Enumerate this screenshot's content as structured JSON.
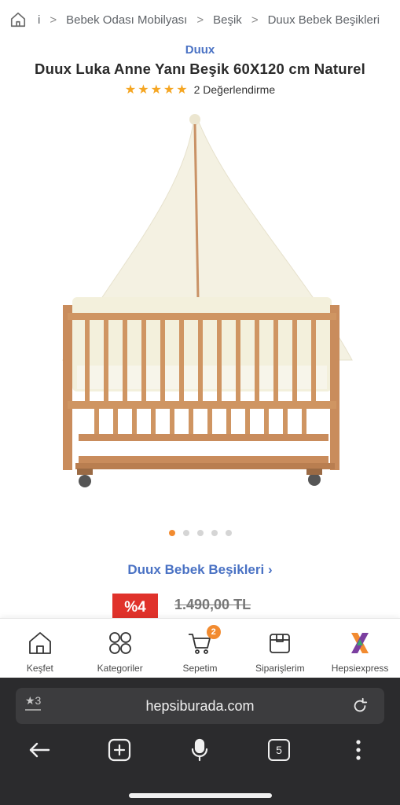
{
  "breadcrumb": {
    "items": [
      "i",
      "Bebek Odası Mobilyası",
      "Beşik",
      "Duux Bebek Beşikleri"
    ]
  },
  "product": {
    "brand": "Duux",
    "title": "Duux Luka Anne Yanı Beşik 60X120 cm Naturel",
    "rating_stars": "★★★★★",
    "rating_value": 5,
    "review_text": "2 Değerlendirme",
    "image_count": 5,
    "active_image": 1
  },
  "collection_link": "Duux Bebek Beşikleri ›",
  "price": {
    "discount": "%4",
    "old_price": "1.490,00 TL"
  },
  "bottom_nav": {
    "items": [
      {
        "label": "Keşfet"
      },
      {
        "label": "Kategoriler"
      },
      {
        "label": "Sepetim",
        "badge": "2"
      },
      {
        "label": "Siparişlerim"
      },
      {
        "label": "Hepsiexpress"
      }
    ]
  },
  "browser": {
    "tabs_label": "★3",
    "url": "hepsiburada.com",
    "tab_count": "5"
  },
  "colors": {
    "accent_orange": "#f28b30",
    "brand_blue": "#4a72c4",
    "discount_red": "#e0322b",
    "star_yellow": "#f5a623",
    "browser_dark": "#2b2b2d"
  }
}
